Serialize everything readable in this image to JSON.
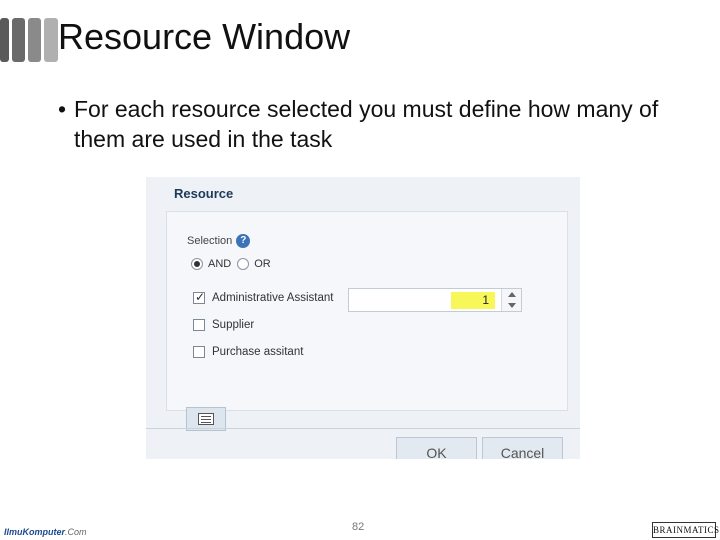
{
  "slide": {
    "title": "Resource Window",
    "bullet": "For each resource selected you must define how many of them are used in the task",
    "page_number": "82",
    "footer_left_brand": "IlmuKomputer",
    "footer_left_suffix": ".Com",
    "footer_right_logo": "BRAINMATICS"
  },
  "dialog": {
    "title": "Resource",
    "selection_label": "Selection",
    "help_icon": "?",
    "radios": [
      {
        "label": "AND",
        "selected": true
      },
      {
        "label": "OR",
        "selected": false
      }
    ],
    "resources": [
      {
        "label": "Administrative Assistant",
        "checked": true,
        "quantity": "1"
      },
      {
        "label": "Supplier",
        "checked": false
      },
      {
        "label": "Purchase assitant",
        "checked": false
      }
    ],
    "buttons": {
      "ok": "OK",
      "cancel": "Cancel"
    },
    "highlight_color": "#f7f75a"
  },
  "icons": {
    "help": "help-icon",
    "list": "list-icon",
    "spin_up": "chevron-up-icon",
    "spin_down": "chevron-down-icon"
  }
}
